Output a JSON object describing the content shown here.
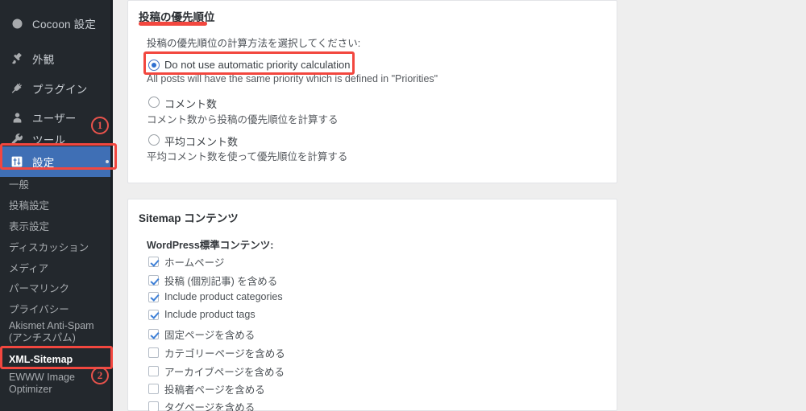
{
  "sidebar": {
    "top_items": [
      {
        "label": "Cocoon 設定",
        "icon": "circle-icon",
        "active": false
      },
      {
        "label": "外観",
        "icon": "paintbrush-icon",
        "active": false
      },
      {
        "label": "プラグイン",
        "icon": "plug-icon",
        "active": false
      },
      {
        "label": "ユーザー",
        "icon": "user-icon",
        "active": false
      },
      {
        "label": "ツール",
        "icon": "wrench-icon",
        "active": false
      },
      {
        "label": "設定",
        "icon": "sliders-icon",
        "active": true
      }
    ],
    "submenu_items": [
      {
        "label": "一般"
      },
      {
        "label": "投稿設定"
      },
      {
        "label": "表示設定"
      },
      {
        "label": "ディスカッション"
      },
      {
        "label": "メディア"
      },
      {
        "label": "パーマリンク"
      },
      {
        "label": "プライバシー"
      },
      {
        "label": "Akismet Anti-Spam (アンチスパム)"
      },
      {
        "label": "XML-Sitemap"
      },
      {
        "label": "EWWW Image Optimizer"
      }
    ]
  },
  "annotations": {
    "marker_one": "1",
    "marker_two": "2"
  },
  "priority_panel": {
    "title": "投稿の優先順位",
    "lead": "投稿の優先順位の計算方法を選択してください:",
    "options": [
      {
        "label": "Do not use automatic priority calculation",
        "description": "All posts will have the same priority which is defined in \"Priorities\"",
        "selected": true
      },
      {
        "label": "コメント数",
        "description": "コメント数から投稿の優先順位を計算する",
        "selected": false
      },
      {
        "label": "平均コメント数",
        "description": "平均コメント数を使って優先順位を計算する",
        "selected": false
      }
    ]
  },
  "sitemap_panel": {
    "title": "Sitemap コンテンツ",
    "section_heading": "WordPress標準コンテンツ:",
    "checkboxes": [
      {
        "label": "ホームページ",
        "checked": true
      },
      {
        "label": "投稿 (個別記事) を含める",
        "checked": true
      },
      {
        "label": "Include product categories",
        "checked": true
      },
      {
        "label": "Include product tags",
        "checked": true
      },
      {
        "label": "固定ページを含める",
        "checked": true
      },
      {
        "label": "カテゴリーページを含める",
        "checked": false
      },
      {
        "label": "アーカイブページを含める",
        "checked": false
      },
      {
        "label": "投稿者ページを含める",
        "checked": false
      },
      {
        "label": "タグページを含める",
        "checked": false
      }
    ]
  },
  "colors": {
    "sidebar_bg": "#23282d",
    "sidebar_active": "#3f6fb5",
    "annotation_red": "#f2473f",
    "page_bg": "#eeeeee",
    "panel_bg": "#ffffff",
    "radio_blue": "#2f6fd0",
    "check_blue": "#3d7fd6"
  }
}
